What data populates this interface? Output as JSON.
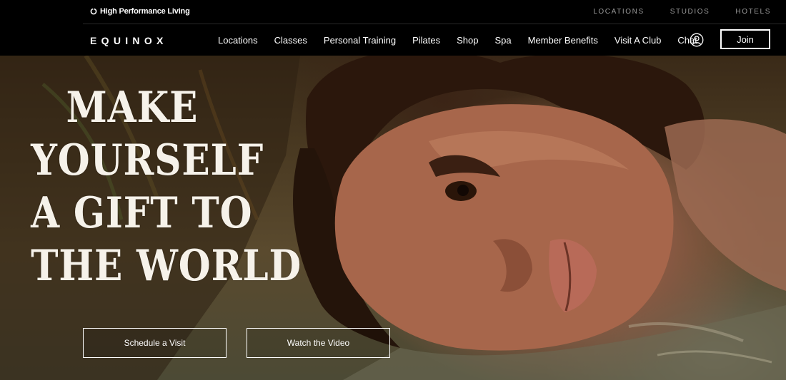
{
  "utility_bar": {
    "brand_tagline": "High Performance Living",
    "links": [
      "LOCATIONS",
      "STUDIOS",
      "HOTELS"
    ]
  },
  "nav": {
    "logo": "EQUINOX",
    "items": [
      "Locations",
      "Classes",
      "Personal Training",
      "Pilates",
      "Shop",
      "Spa",
      "Member Benefits",
      "Visit A Club",
      "Chat"
    ],
    "join_label": "Join"
  },
  "hero": {
    "headline_lines": [
      "MAKE",
      "YOURSELF",
      "A GIFT TO",
      "THE WORLD"
    ],
    "cta_primary": "Schedule a Visit",
    "cta_secondary": "Watch the Video"
  },
  "colors": {
    "background": "#000000",
    "text": "#ffffff",
    "utility_link": "#9a9a9a"
  }
}
